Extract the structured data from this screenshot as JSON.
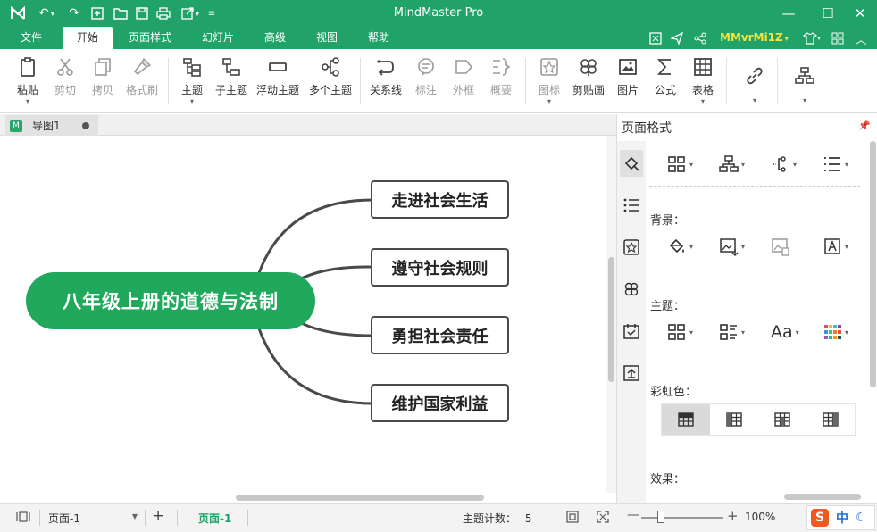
{
  "app": {
    "title": "MindMaster Pro",
    "brand_color": "#20a268",
    "user_name": "MMvrMi1Z",
    "user_color": "#f7e23a"
  },
  "quick_access": [
    "logo-icon",
    "undo-icon",
    "redo-icon",
    "new-icon",
    "open-icon",
    "save-icon",
    "print-icon",
    "export-icon",
    "customize-icon"
  ],
  "window_controls": [
    "minimize-icon",
    "maximize-icon",
    "close-icon"
  ],
  "menu": {
    "tabs": [
      "文件",
      "开始",
      "页面样式",
      "幻灯片",
      "高级",
      "视图",
      "帮助"
    ],
    "active": "开始",
    "right_icons": [
      "fullscreen-icon",
      "send-icon",
      "share-icon",
      "shirt-icon",
      "grid-icon",
      "collapse-icon"
    ]
  },
  "ribbon": {
    "buttons": [
      {
        "label": "粘贴",
        "icon": "paste-icon"
      },
      {
        "label": "剪切",
        "icon": "scissors-icon"
      },
      {
        "label": "拷贝",
        "icon": "copy-icon"
      },
      {
        "label": "格式刷",
        "icon": "format-brush-icon"
      },
      {
        "label": "主题",
        "icon": "topic-icon"
      },
      {
        "label": "子主题",
        "icon": "subtopic-icon"
      },
      {
        "label": "浮动主题",
        "icon": "floating-topic-icon"
      },
      {
        "label": "多个主题",
        "icon": "multiple-topics-icon"
      },
      {
        "label": "关系线",
        "icon": "relationship-icon"
      },
      {
        "label": "标注",
        "icon": "callout-icon"
      },
      {
        "label": "外框",
        "icon": "boundary-icon"
      },
      {
        "label": "概要",
        "icon": "summary-icon"
      },
      {
        "label": "图标",
        "icon": "mark-icon"
      },
      {
        "label": "剪贴画",
        "icon": "clipart-icon"
      },
      {
        "label": "图片",
        "icon": "picture-icon"
      },
      {
        "label": "公式",
        "icon": "formula-icon"
      },
      {
        "label": "表格",
        "icon": "table-icon"
      },
      {
        "label": "",
        "icon": "link-icon"
      },
      {
        "label": "",
        "icon": "layout-icon"
      }
    ]
  },
  "document": {
    "tab_name": "导图1"
  },
  "mindmap": {
    "central_topic": "八年级上册的道德与法制",
    "topics": [
      "走进社会生活",
      "遵守社会规则",
      "勇担社会责任",
      "维护国家利益"
    ]
  },
  "panel": {
    "title": "页面格式",
    "sections": {
      "background": "背景：",
      "theme": "主题：",
      "rainbow": "彩虹色：",
      "effect": "效果："
    },
    "side_icons": [
      "format-icon",
      "outline-icon",
      "mark-icon",
      "clipart-icon",
      "task-icon",
      "upload-icon"
    ]
  },
  "status": {
    "page_select": "页面-1",
    "page_tab": "页面-1",
    "topic_count_label": "主题计数：",
    "topic_count": "5",
    "zoom": "100%",
    "ime_text": "中"
  }
}
